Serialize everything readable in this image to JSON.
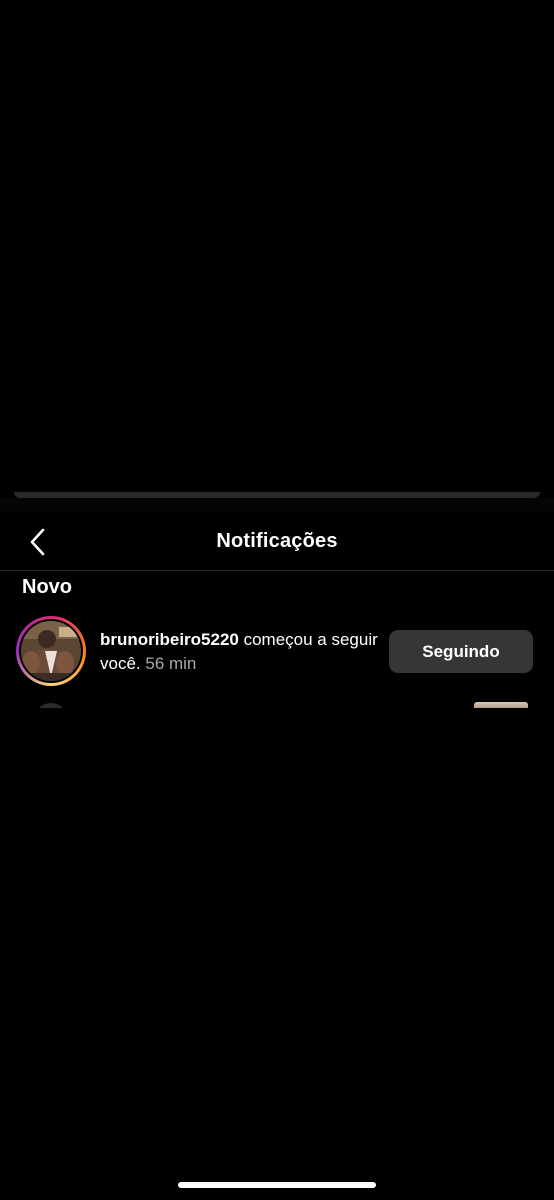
{
  "header": {
    "title": "Notificações",
    "back_icon": "chevron-left-icon"
  },
  "sections": [
    {
      "title": "Novo",
      "items": [
        {
          "username": "brunoribeiro5220",
          "action": " começou a seguir você.",
          "time": " 56 min",
          "button_label": "Seguindo"
        }
      ]
    }
  ],
  "colors": {
    "background": "#000000",
    "button_bg": "#363636",
    "secondary_text": "#a8a8a8",
    "divider": "#262626"
  }
}
